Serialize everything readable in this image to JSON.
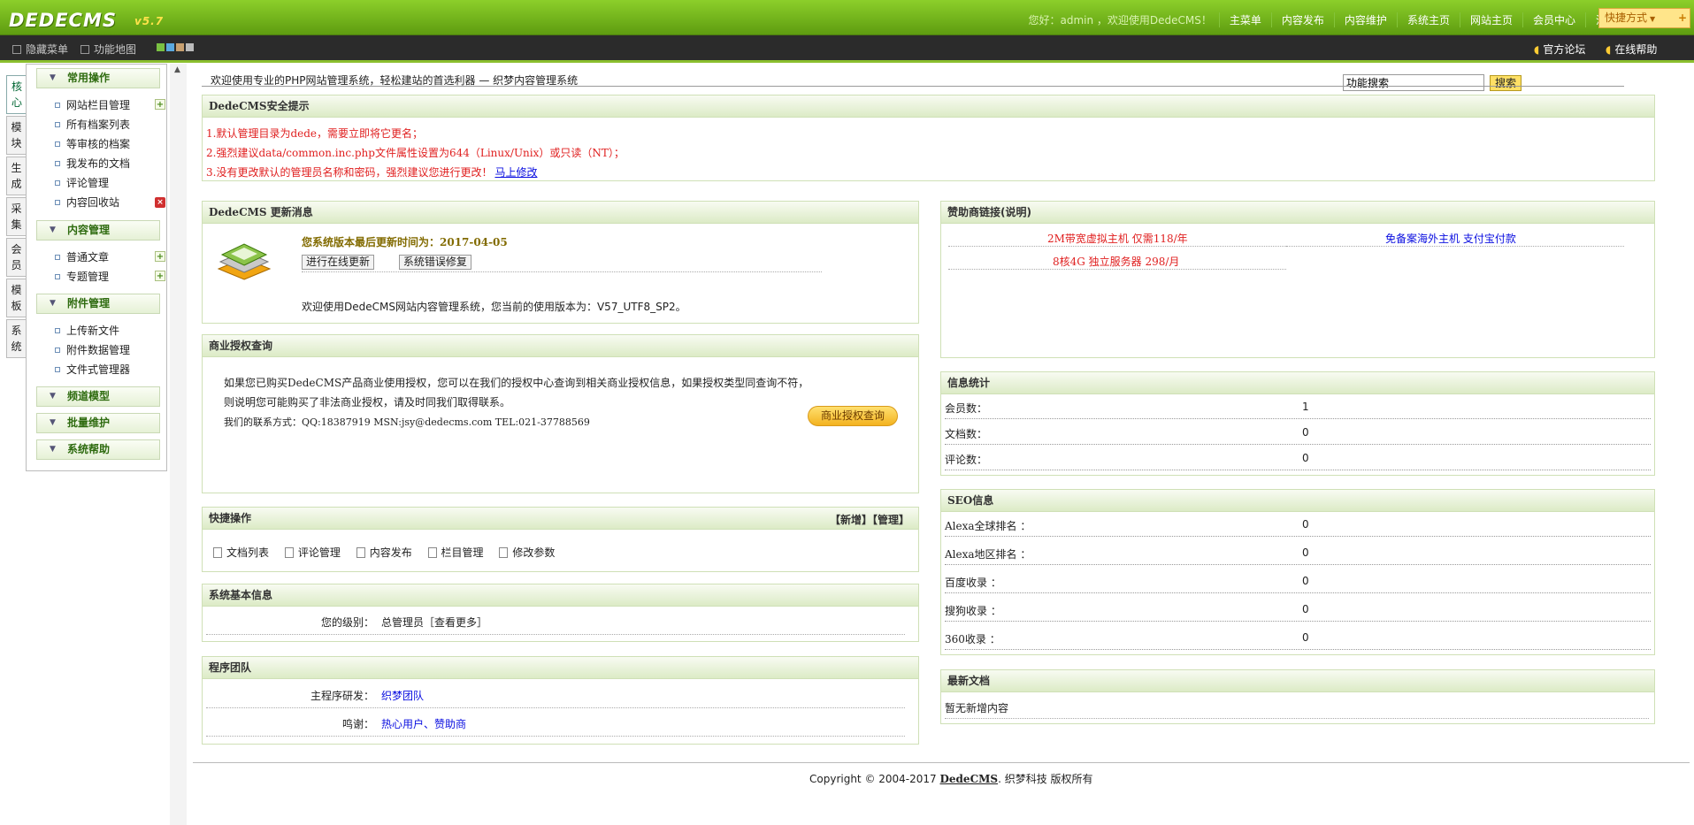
{
  "app": {
    "logo": "DEDECMS",
    "version": "v5.7"
  },
  "topnav": {
    "greeting": "您好：admin ，欢迎使用DedeCMS！",
    "items": [
      "主菜单",
      "内容发布",
      "内容维护",
      "系统主页",
      "网站主页",
      "会员中心",
      "注销"
    ],
    "quick": "快捷方式"
  },
  "subbar": {
    "hide_menu": "隐藏菜单",
    "func_map": "功能地图",
    "search_value": "功能搜索",
    "search_btn": "搜索",
    "forum": "官方论坛",
    "help": "在线帮助"
  },
  "lefttabs": [
    "核心",
    "模块",
    "生成",
    "采集",
    "会员",
    "模板",
    "系统"
  ],
  "menu": {
    "g1": "常用操作",
    "g1_items": [
      "网站栏目管理",
      "所有档案列表",
      "等审核的档案",
      "我发布的文档",
      "评论管理",
      "内容回收站"
    ],
    "g2": "内容管理",
    "g2_items": [
      "普通文章",
      "专题管理"
    ],
    "g3": "附件管理",
    "g3_items": [
      "上传新文件",
      "附件数据管理",
      "文件式管理器"
    ],
    "g4": "频道模型",
    "g5": "批量维护",
    "g6": "系统帮助"
  },
  "welcome": "欢迎使用专业的PHP网站管理系统，轻松建站的首选利器 — 织梦内容管理系统",
  "security": {
    "title": "DedeCMS安全提示",
    "l1": "1.默认管理目录为dede，需要立即将它更名；",
    "l2": "2.强烈建议data/common.inc.php文件属性设置为644（Linux/Unix）或只读（NT）；",
    "l3": "3.没有更改默认的管理员名称和密码，强烈建议您进行更改！",
    "l3_link": "马上修改"
  },
  "update": {
    "title": "DedeCMS 更新消息",
    "date": "您系统版本最后更新时间为：2017-04-05",
    "btn1": "进行在线更新",
    "btn2": "系统错误修复",
    "ver": "欢迎使用DedeCMS网站内容管理系统，您当前的使用版本为：V57_UTF8_SP2。"
  },
  "license": {
    "title": "商业授权查询",
    "t1": "如果您已购买DedeCMS产品商业使用授权，您可以在我们的授权中心查询到相关商业授权信息，如果授权类型同查询不符，",
    "t2": "则说明您可能购买了非法商业授权，请及时同我们取得联系。",
    "t3": "我们的联系方式：QQ:18387919 MSN:jsy@dedecms.com TEL:021-37788569",
    "btn": "商业授权查询"
  },
  "quickops": {
    "title": "快捷操作",
    "links": "【新增】【管理】",
    "items": [
      "文档列表",
      "评论管理",
      "内容发布",
      "栏目管理",
      "修改参数"
    ]
  },
  "sysinfo": {
    "title": "系统基本信息",
    "label": "您的级别：",
    "value": "总管理员［查看更多］"
  },
  "team": {
    "title": "程序团队",
    "dev_label": "主程序研发：",
    "dev": "织梦团队",
    "thanks_label": "鸣谢：",
    "thanks": "热心用户、赞助商"
  },
  "sponsor": {
    "title": "赞助商链接(说明)",
    "s1": "2M带宽虚拟主机 仅需118/年",
    "s2": "免备案海外主机 支付宝付款",
    "s3": "8核4G 独立服务器 298/月"
  },
  "stats": {
    "title": "信息统计",
    "rows": [
      {
        "k": "会员数：",
        "v": "1"
      },
      {
        "k": "文档数：",
        "v": "0"
      },
      {
        "k": "评论数：",
        "v": "0"
      }
    ]
  },
  "seo": {
    "title": "SEO信息",
    "rows": [
      {
        "k": "Alexa全球排名 ：",
        "v": "0"
      },
      {
        "k": "Alexa地区排名 ：",
        "v": "0"
      },
      {
        "k": "百度收录 ：",
        "v": "0"
      },
      {
        "k": "搜狗收录 ：",
        "v": "0"
      },
      {
        "k": "360收录 ：",
        "v": "0"
      }
    ]
  },
  "latest": {
    "title": "最新文档",
    "empty": "暂无新增内容"
  },
  "footer": {
    "pre": "Copyright © 2004-2017 ",
    "brand": "DedeCMS",
    "post": ". 织梦科技 版权所有"
  },
  "colors": {
    "brand_green": "#6fb51c",
    "link_blue": "#0a0ee0",
    "warn_red": "#e02020"
  }
}
